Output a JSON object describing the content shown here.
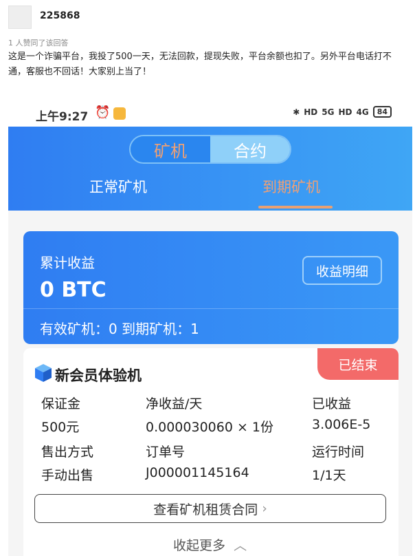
{
  "post": {
    "username": "225868",
    "likes": "1 人赞同了该回答",
    "text": "这是一个诈骗平台，我投了500一天，无法回款，提现失败，平台余额也扣了。另外平台电话打不通，客服也不回话！大家别上当了！"
  },
  "phone": {
    "status_bar": {
      "time": "上午9:27",
      "alarm_icon": "alarm-clock-icon",
      "bluetooth": "✱",
      "hd1": "HD",
      "net1": "5G",
      "hd2": "HD",
      "net2": "4G",
      "battery": "84"
    },
    "toggle": [
      "矿机",
      "合约"
    ],
    "tabs": {
      "normal": "正常矿机",
      "expired": "到期矿机"
    },
    "earnings": {
      "label": "累计收益",
      "value": "0 BTC",
      "detail_button": "收益明细",
      "footer": "有效矿机：0   到期矿机：1"
    },
    "machine": {
      "badge": "已结束",
      "title": "新会员体验机",
      "labels": {
        "deposit": "保证金",
        "net_income": "净收益/天",
        "earned": "已收益",
        "sale_method": "售出方式",
        "order_no": "订单号",
        "run_time": "运行时间"
      },
      "values": {
        "deposit": "500元",
        "net_income": "0.000030060 × 1份",
        "earned": "3.006E-5",
        "sale_method": "手动出售",
        "order_no": "J000001145164",
        "run_time": "1/1天"
      },
      "contract_button": "查看矿机租赁合同",
      "collapse": "收起更多"
    }
  },
  "colors": {
    "accent_blue": "#2f7df2",
    "accent_orange": "#f0a074",
    "badge_red": "#f36a69"
  }
}
